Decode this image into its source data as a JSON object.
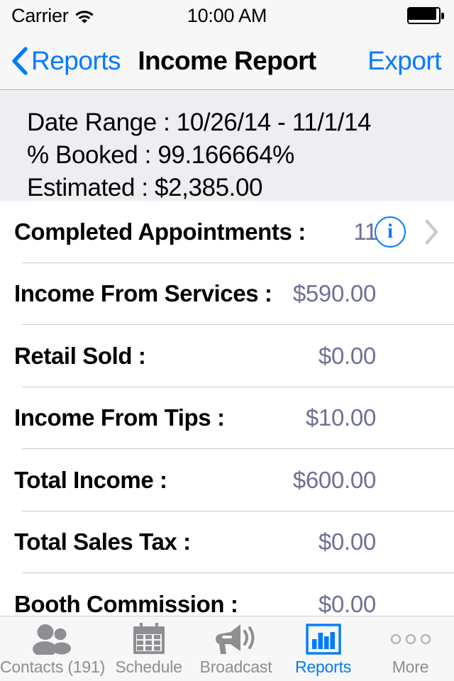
{
  "status_bar": {
    "carrier": "Carrier",
    "wifi_icon": "wifi-icon",
    "time": "10:00 AM",
    "battery_icon": "battery-full-icon"
  },
  "nav_bar": {
    "back_icon": "chevron-left-icon",
    "back_label": "Reports",
    "title": "Income Report",
    "export_label": "Export"
  },
  "summary": {
    "lines": [
      "Date Range : 10/26/14 - 11/1/14",
      "% Booked : 99.166664%",
      "Estimated : $2,385.00"
    ]
  },
  "rows": [
    {
      "label": "Completed Appointments :",
      "value": "11",
      "has_info": true,
      "has_disclosure": true,
      "info_icon": "info-circle-icon",
      "disclosure_icon": "chevron-right-icon"
    },
    {
      "label": "Income From Services :",
      "value": "$590.00",
      "has_info": false,
      "has_disclosure": false
    },
    {
      "label": "Retail Sold :",
      "value": "$0.00",
      "has_info": false,
      "has_disclosure": false
    },
    {
      "label": "Income From Tips :",
      "value": "$10.00",
      "has_info": false,
      "has_disclosure": false
    },
    {
      "label": "Total Income :",
      "value": "$600.00",
      "has_info": false,
      "has_disclosure": false
    },
    {
      "label": "Total Sales Tax :",
      "value": "$0.00",
      "has_info": false,
      "has_disclosure": false
    },
    {
      "label": "Booth Commission :",
      "value": "$0.00",
      "has_info": false,
      "has_disclosure": false
    }
  ],
  "watermark": "Booth Commission",
  "tab_bar": {
    "tabs": [
      {
        "label": "Contacts (191)",
        "icon": "contacts-people-icon",
        "active": false
      },
      {
        "label": "Schedule",
        "icon": "calendar-icon",
        "active": false
      },
      {
        "label": "Broadcast",
        "icon": "megaphone-icon",
        "active": false
      },
      {
        "label": "Reports",
        "icon": "bar-chart-icon",
        "active": true
      },
      {
        "label": "More",
        "icon": "ellipsis-icon",
        "active": false
      }
    ]
  },
  "colors": {
    "accent_blue": "#027aff",
    "value_text": "#6e7096",
    "inactive_gray": "#8e8e93",
    "summary_bg": "#eeeef2",
    "bar_bg": "#f7f7f7",
    "separator": "#c8c7cc"
  },
  "chart_data": {
    "type": "table",
    "title": "Income Report",
    "subtitle": "Date Range : 10/26/14 - 11/1/14",
    "categories": [
      "Completed Appointments",
      "Income From Services",
      "Retail Sold",
      "Income From Tips",
      "Total Income",
      "Total Sales Tax",
      "Booth Commission"
    ],
    "values": [
      11,
      590.0,
      0.0,
      10.0,
      600.0,
      0.0,
      0.0
    ],
    "display_values": [
      "11",
      "$590.00",
      "$0.00",
      "$10.00",
      "$600.00",
      "$0.00",
      "$0.00"
    ],
    "summary_metrics": {
      "date_range_start": "10/26/14",
      "date_range_end": "11/1/14",
      "percent_booked": 99.166664,
      "estimated": 2385.0
    },
    "xlabel": "",
    "ylabel": ""
  }
}
